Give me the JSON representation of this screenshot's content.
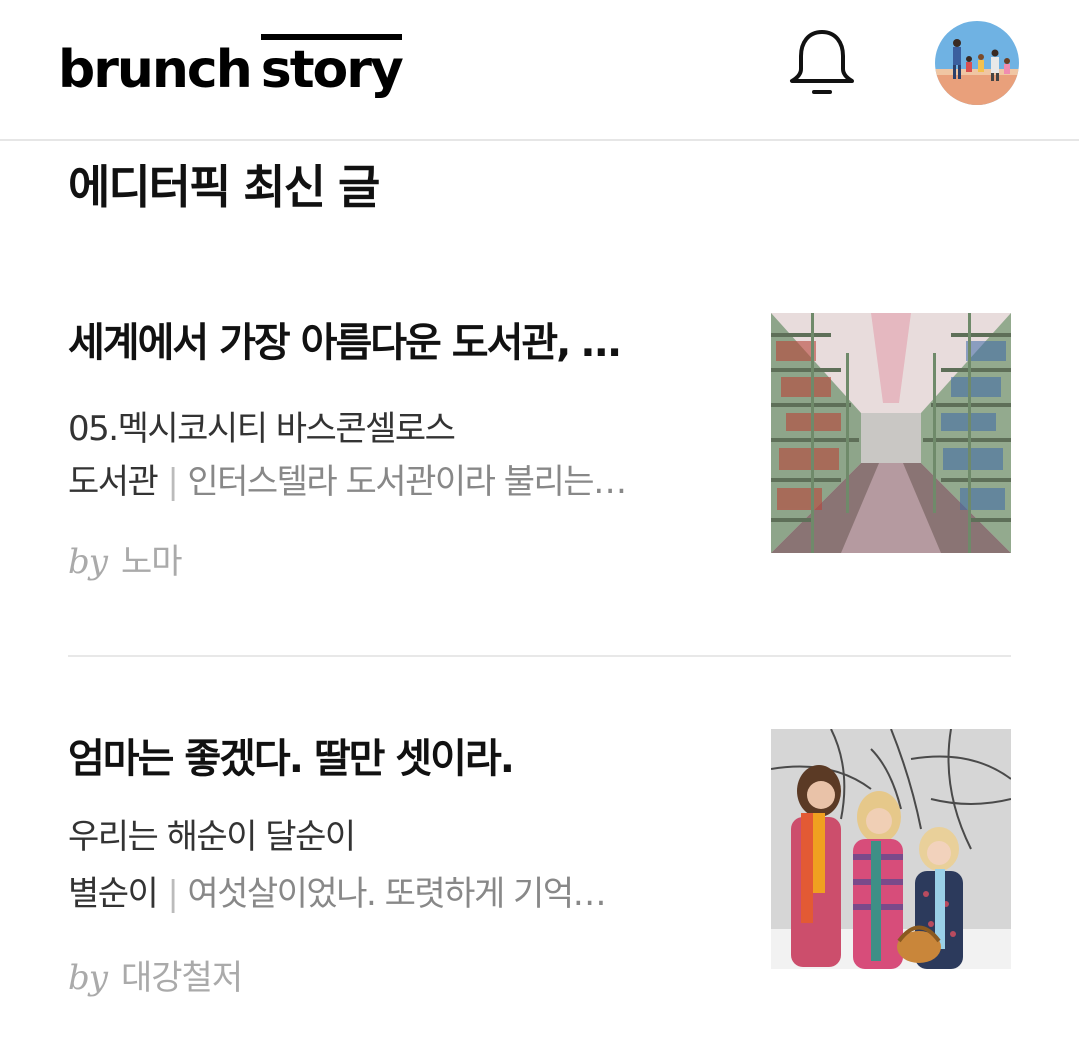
{
  "header": {
    "logo_word1": "brunch",
    "logo_word2": "story",
    "notification_icon": "bell-icon",
    "avatar_icon": "profile-avatar"
  },
  "section": {
    "title": "에디터픽 최신 글"
  },
  "articles": [
    {
      "title": "세계에서 가장 아름다운 도서관, …",
      "subtitle_line1": "05.멕시코시티 바스콘셀로스",
      "subtitle_line2": "도서관",
      "separator": "|",
      "excerpt": "인터스텔라 도서관이라 불리는…",
      "by": "by",
      "author": "노마",
      "thumbnail": "library-photo"
    },
    {
      "title": "엄마는 좋겠다. 딸만 셋이라.",
      "subtitle_line1": "우리는 해순이 달순이",
      "subtitle_line2": "별순이",
      "separator": "|",
      "excerpt": "여섯살이었나. 또렷하게 기억…",
      "by": "by",
      "author": "대강철저",
      "thumbnail": "three-girls-snow-photo"
    }
  ]
}
